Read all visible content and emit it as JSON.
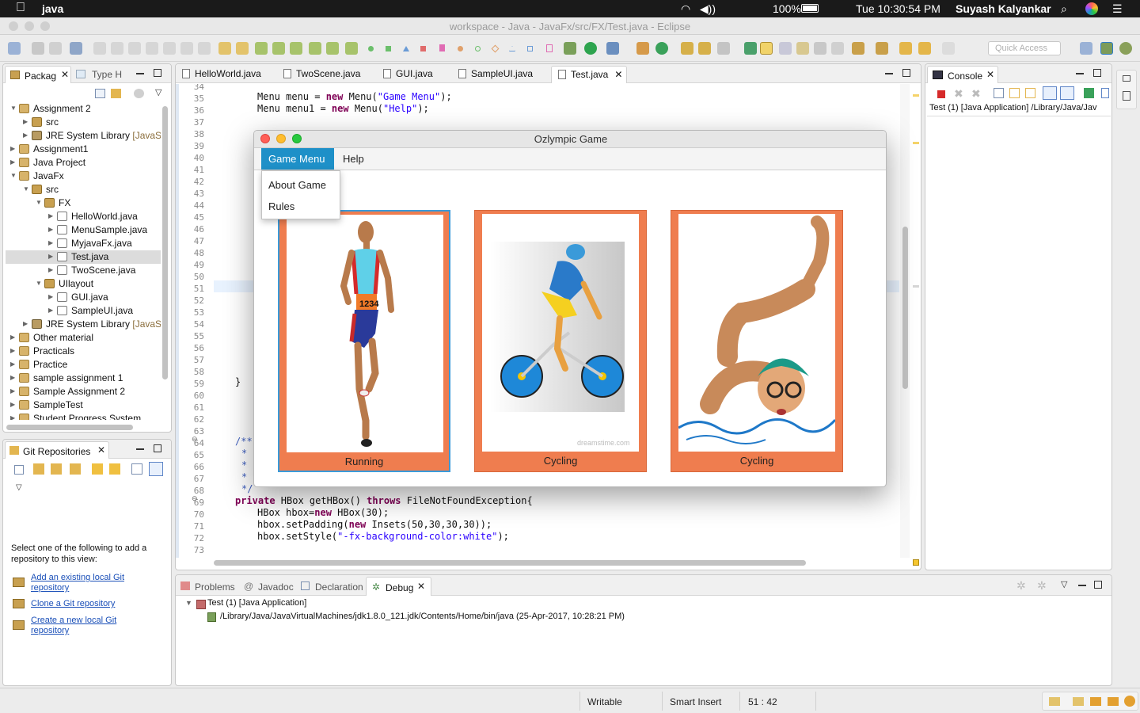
{
  "menubar": {
    "app": "java",
    "battery": "100%",
    "datetime": "Tue 10:30:54 PM",
    "user": "Suyash Kalyankar"
  },
  "window": {
    "title": "workspace - Java - JavaFx/src/FX/Test.java - Eclipse"
  },
  "toolbar": {
    "quick_access_placeholder": "Quick Access"
  },
  "package_explorer": {
    "tabs": [
      "Packag",
      "Type H"
    ],
    "tree": [
      {
        "label": "Assignment 2",
        "kind": "proj",
        "depth": 0,
        "arrow": "▼"
      },
      {
        "label": "src",
        "kind": "pkg",
        "depth": 1,
        "arrow": "▶"
      },
      {
        "label": "JRE System Library",
        "dim": "[JavaS",
        "kind": "lib",
        "depth": 1,
        "arrow": "▶"
      },
      {
        "label": "Assignment1",
        "kind": "proj",
        "depth": 0,
        "arrow": "▶"
      },
      {
        "label": "Java Project",
        "kind": "proj",
        "depth": 0,
        "arrow": "▶"
      },
      {
        "label": "JavaFx",
        "kind": "proj",
        "depth": 0,
        "arrow": "▼"
      },
      {
        "label": "src",
        "kind": "pkg",
        "depth": 1,
        "arrow": "▼"
      },
      {
        "label": "FX",
        "kind": "pkg",
        "depth": 2,
        "arrow": "▼"
      },
      {
        "label": "HelloWorld.java",
        "kind": "jfile",
        "depth": 3,
        "arrow": "▶"
      },
      {
        "label": "MenuSample.java",
        "kind": "jfile",
        "depth": 3,
        "arrow": "▶"
      },
      {
        "label": "MyjavaFx.java",
        "kind": "jfile",
        "depth": 3,
        "arrow": "▶"
      },
      {
        "label": "Test.java",
        "kind": "jfile",
        "depth": 3,
        "arrow": "▶",
        "selected": true
      },
      {
        "label": "TwoScene.java",
        "kind": "jfile",
        "depth": 3,
        "arrow": "▶"
      },
      {
        "label": "UIlayout",
        "kind": "pkg",
        "depth": 2,
        "arrow": "▼"
      },
      {
        "label": "GUI.java",
        "kind": "jfile",
        "depth": 3,
        "arrow": "▶"
      },
      {
        "label": "SampleUI.java",
        "kind": "jfile",
        "depth": 3,
        "arrow": "▶"
      },
      {
        "label": "JRE System Library",
        "dim": "[JavaS",
        "kind": "lib",
        "depth": 1,
        "arrow": "▶"
      },
      {
        "label": "Other material",
        "kind": "proj",
        "depth": 0,
        "arrow": "▶"
      },
      {
        "label": "Practicals",
        "kind": "proj",
        "depth": 0,
        "arrow": "▶"
      },
      {
        "label": "Practice",
        "kind": "proj",
        "depth": 0,
        "arrow": "▶"
      },
      {
        "label": "sample assignment 1",
        "kind": "proj",
        "depth": 0,
        "arrow": "▶"
      },
      {
        "label": "Sample Assignment 2",
        "kind": "proj",
        "depth": 0,
        "arrow": "▶"
      },
      {
        "label": "SampleTest",
        "kind": "proj",
        "depth": 0,
        "arrow": "▶"
      },
      {
        "label": "Student Progress System",
        "kind": "proj",
        "depth": 0,
        "arrow": "▶"
      }
    ]
  },
  "git": {
    "title": "Git Repositories",
    "info": "Select one of the following to add a repository to this view:",
    "links": [
      {
        "line1": "Add an existing local Git",
        "line2": "repository"
      },
      {
        "line1": "Clone a Git repository",
        "line2": ""
      },
      {
        "line1": "Create a new local Git",
        "line2": "repository"
      }
    ]
  },
  "editor": {
    "tabs": [
      "HelloWorld.java",
      "TwoScene.java",
      "GUI.java",
      "SampleUI.java",
      "Test.java"
    ],
    "active_tab": "Test.java",
    "line_numbers": [
      "34",
      "35",
      "36",
      "37",
      "38",
      "39",
      "40",
      "41",
      "42",
      "43",
      "44",
      "45",
      "46",
      "47",
      "48",
      "49",
      "50",
      "51",
      "52",
      "53",
      "54",
      "55",
      "56",
      "57",
      "58",
      "59",
      "60",
      "61",
      "62",
      "63",
      "64",
      "65",
      "66",
      "67",
      "68",
      "69",
      "70",
      "71",
      "72",
      "73"
    ]
  },
  "console": {
    "title": "Console",
    "text": "Test (1) [Java Application] /Library/Java/Jav"
  },
  "app_window": {
    "title": "Ozlympic Game",
    "menus": [
      "Game Menu",
      "Help"
    ],
    "dropdown": [
      "About Game",
      "Rules"
    ],
    "cards": [
      {
        "caption": "Running",
        "image": "runner-image",
        "selected": true
      },
      {
        "caption": "Cycling",
        "image": "cyclist-image",
        "selected": false
      },
      {
        "caption": "Cycling",
        "image": "swimmer-image",
        "selected": false
      }
    ],
    "watermark": "dreamstime.com"
  },
  "bottom": {
    "tabs": [
      "Problems",
      "Javadoc",
      "Declaration",
      "Debug"
    ],
    "active_tab": "Debug",
    "debug_root": "Test (1) [Java Application]",
    "debug_child": "/Library/Java/JavaVirtualMachines/jdk1.8.0_121.jdk/Contents/Home/bin/java (25-Apr-2017, 10:28:21 PM)"
  },
  "statusbar": {
    "mode": "Writable",
    "insert": "Smart Insert",
    "position": "51 : 42"
  },
  "colors": {
    "accent": "#1e90c8",
    "card_orange": "#ef7d4f",
    "selected_border": "#3a9ad9"
  }
}
